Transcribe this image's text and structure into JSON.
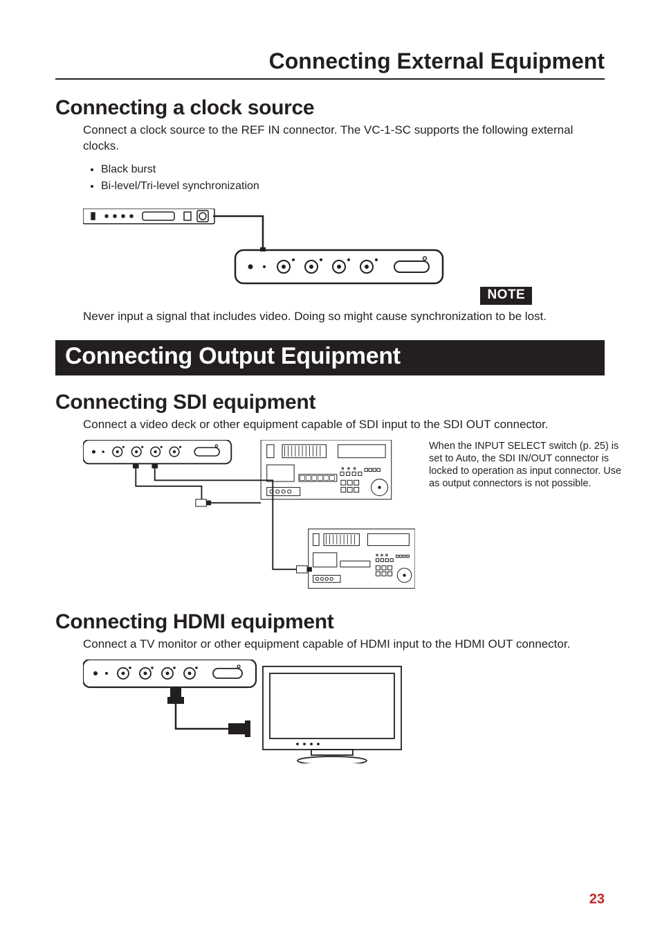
{
  "header": {
    "title": "Connecting External Equipment"
  },
  "section1": {
    "heading": "Connecting a clock source",
    "intro": "Connect a clock source to the REF IN connector. The VC-1-SC supports the following external clocks.",
    "bullets": [
      "Black burst",
      "Bi-level/Tri-level synchronization"
    ],
    "note_label": "NOTE",
    "note_text": "Never input a signal that includes video. Doing so might cause synchronization to be lost."
  },
  "section2": {
    "heading": "Connecting Output Equipment"
  },
  "section2a": {
    "heading": "Connecting SDI equipment",
    "intro": "Connect a video deck or other equipment capable of SDI input to the SDI OUT connector.",
    "side_note": "When the INPUT SELECT switch (p. 25) is set to Auto, the SDI IN/OUT connector is locked to operation as input connector. Use as output connectors is not possible."
  },
  "section2b": {
    "heading": "Connecting HDMI equipment",
    "intro": "Connect a TV monitor or other equipment capable of HDMI input to the HDMI OUT connector."
  },
  "page_number": "23"
}
